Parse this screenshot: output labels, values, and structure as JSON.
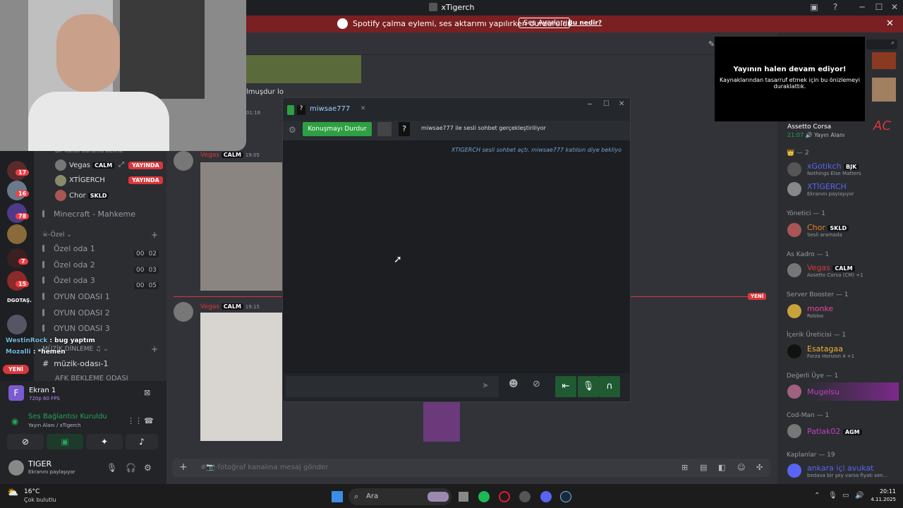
{
  "window": {
    "title": "xTigerch"
  },
  "notice": {
    "message": "Spotify çalma eylemi, ses aktarımı yapılırken durduruldu.",
    "button": "Ses Ayarları",
    "link": "Bu nedir?"
  },
  "rail": {
    "badges": [
      "17",
      "16",
      "78",
      "7",
      "15"
    ],
    "label": "DGOTAŞ.",
    "new_pill": "YENİ"
  },
  "sidebar": {
    "status_hint": "Bir kanal durumu belirle",
    "live_members": [
      {
        "name": "Vegas",
        "tag": "CALM",
        "live": "YAYINDA"
      },
      {
        "name": "XTİGERCH",
        "live": "YAYINDA"
      },
      {
        "name": "Chor",
        "tag": "SKLD"
      }
    ],
    "channels": [
      {
        "name": "Minecraft - Mahkeme"
      },
      {
        "name": "Özel oda 1",
        "count_a": "00",
        "count_b": "02"
      },
      {
        "name": "Özel oda 2",
        "count_a": "00",
        "count_b": "03"
      },
      {
        "name": "Özel oda 3",
        "count_a": "00",
        "count_b": "05"
      },
      {
        "name": "OYUN ODASI 1"
      },
      {
        "name": "OYUN ODASI 2"
      },
      {
        "name": "OYUN ODASI 3"
      }
    ],
    "category_ozel": "-Özel",
    "category_music": "MÜZİK DİNLEME",
    "music_channel": "müzik-odası-1",
    "afk_channel": "AFK BEKLEME ODASI",
    "chat_overlay": [
      {
        "name": "WestinRock",
        "text": "bug yaptım"
      },
      {
        "name": "Mozalli",
        "text": "*hemen"
      }
    ]
  },
  "voice_panel": {
    "stream_title": "Ekran 1",
    "stream_sub": "720p 60 FPS",
    "connection": "Ses Bağlantısı Kuruldu",
    "connection_sub": "Yayın Alanı / xTigerch",
    "user": "TIGER",
    "user_status": "Ekranını paylaşıyor"
  },
  "chat": {
    "top_fragment": "lmuşdur lo",
    "time0": "01:16",
    "messages": [
      {
        "author": "Vegas",
        "tag": "CALM",
        "time": "19:05"
      },
      {
        "author": "Vegas",
        "tag": "CALM",
        "time": "19:15"
      }
    ],
    "new_divider": "YENİ",
    "placeholder": "#📷-fotoğraf kanalına mesaj gönder"
  },
  "overlay": {
    "title": "Yayının halen devam ediyor!",
    "body": "Kaynaklarından tasarruf etmek için bu önizlemeyi duraklattık."
  },
  "steam_chat": {
    "tab": "miwsae777",
    "stop_button": "Konuşmayı Durdur",
    "status": "miwsae777 ile sesli sohbet gerçekleştiriliyor",
    "system_msg": "XTIGERCH sesli sohbet açtı. miwsae777 katılsın diye bekliyo"
  },
  "members": {
    "top_item": {
      "name": "Assetto Corsa",
      "time": "21:07",
      "sub": "Yayın Alanı"
    },
    "groups": [
      {
        "header": "— 2",
        "items": [
          {
            "name": "xGotikch",
            "tag": "BJK",
            "sub": "Nothings Else Matters",
            "color": "#5865f2"
          },
          {
            "name": "XTİGERCH",
            "sub": "Ekranını paylaşıyor",
            "color": "#5865f2"
          }
        ]
      },
      {
        "header": "Yönetici — 1",
        "items": [
          {
            "name": "Chor",
            "tag": "SKLD",
            "sub": "Sesli aramada",
            "color": "#e67e22"
          }
        ]
      },
      {
        "header": "As Kadro — 1",
        "items": [
          {
            "name": "Vegas",
            "tag": "CALM",
            "sub": "Assetto Corsa (CM) +1",
            "color": "#da373c"
          }
        ]
      },
      {
        "header": "Server Booster — 1",
        "items": [
          {
            "name": "monke",
            "sub": "Roblox",
            "color": "#eb459e"
          }
        ]
      },
      {
        "header": "İçerik Üreticisi — 1",
        "items": [
          {
            "name": "Esatagaa",
            "sub": "Forza Horizon 4 +1",
            "color": "#f0b232"
          }
        ]
      },
      {
        "header": "Değerli Üye — 1",
        "items": [
          {
            "name": "Mugelsu",
            "color": "#c040c0"
          }
        ]
      },
      {
        "header": "Cod-Man — 1",
        "items": [
          {
            "name": "Patlak02",
            "tag": "AGM",
            "color": "#c040c0"
          }
        ]
      },
      {
        "header": "Kaplanlar — 19",
        "items": [
          {
            "name": "ankara içi avukat",
            "sub": "bedava bir şey varsa fiyatı sen...",
            "color": "#5865f2"
          }
        ]
      }
    ]
  },
  "taskbar": {
    "weather_temp": "16°C",
    "weather_desc": "Çok bulutlu",
    "search": "Ara",
    "time": "20:11",
    "date": "4.11.2025"
  },
  "colors": {
    "accent": "#5865f2",
    "danger": "#da373c",
    "online": "#23a55a",
    "steam_green": "#2ea043"
  }
}
